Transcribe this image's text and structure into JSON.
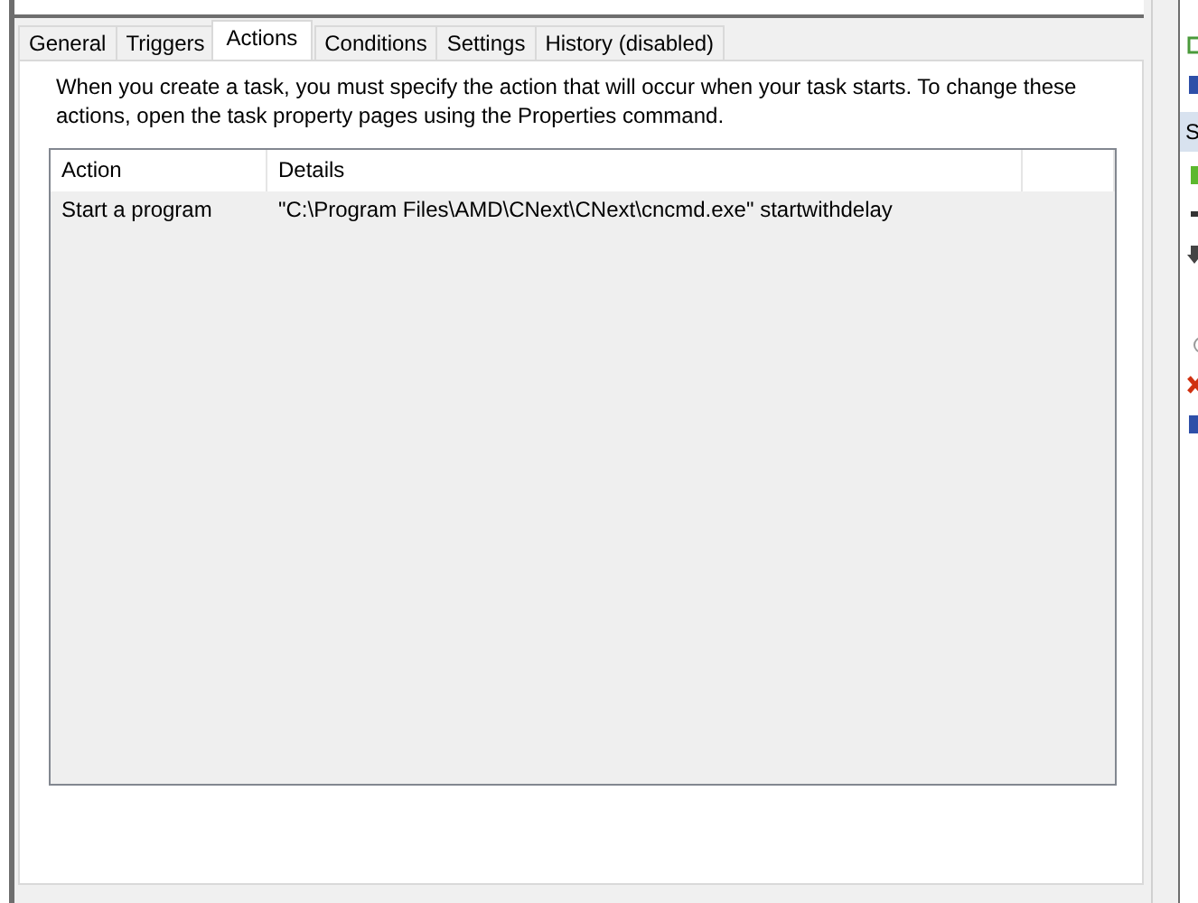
{
  "tabs": [
    {
      "label": "General",
      "selected": false
    },
    {
      "label": "Triggers",
      "selected": false
    },
    {
      "label": "Actions",
      "selected": true
    },
    {
      "label": "Conditions",
      "selected": false
    },
    {
      "label": "Settings",
      "selected": false
    },
    {
      "label": "History (disabled)",
      "selected": false
    }
  ],
  "description": "When you create a task, you must specify the action that will occur when your task starts.  To change these actions, open the task property pages using the Properties command.",
  "table": {
    "columns": [
      "Action",
      "Details"
    ],
    "rows": [
      {
        "cells": [
          "Start a program",
          "\"C:\\Program Files\\AMD\\CNext\\CNext\\cncmd.exe\" startwithdelay"
        ]
      }
    ]
  },
  "actions_pane": {
    "header": "S"
  }
}
